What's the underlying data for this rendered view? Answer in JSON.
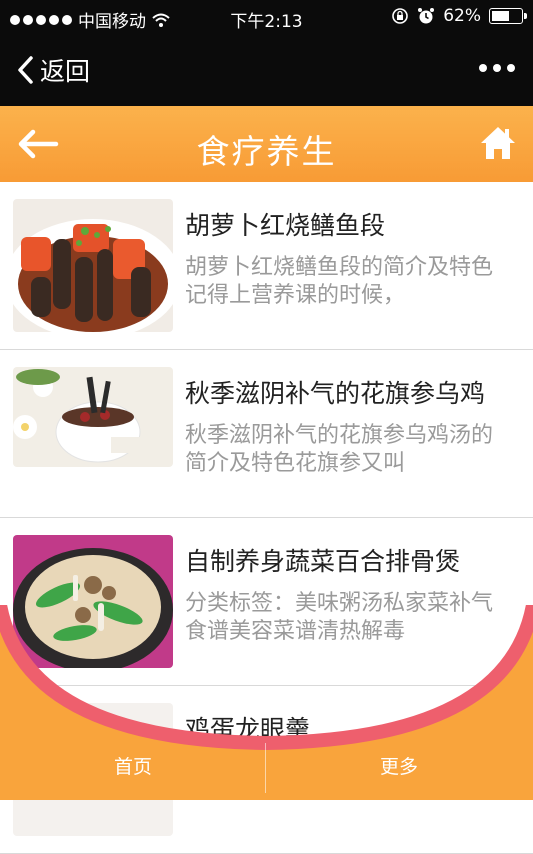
{
  "status_bar": {
    "carrier": "中国移动",
    "time": "下午2:13",
    "battery_percent": "62%",
    "battery_level": 0.62,
    "signal_icon": "signal-icon",
    "wifi_icon": "wifi-icon"
  },
  "nav": {
    "back_label": "返回",
    "more_icon": "more-icon"
  },
  "header": {
    "title": "食疗养生",
    "back_icon": "back-arrow-icon",
    "home_icon": "home-icon"
  },
  "articles": [
    {
      "title": "胡萝卜红烧鳝鱼段",
      "desc": "胡萝卜红烧鳝鱼段的简介及特色记得上营养课的时候，"
    },
    {
      "title": "秋季滋阴补气的花旗参乌鸡",
      "desc": "秋季滋阴补气的花旗参乌鸡汤的简介及特色花旗参又叫"
    },
    {
      "title": "自制养身蔬菜百合排骨煲",
      "desc": "分类标签：美味粥汤私家菜补气食谱美容菜谱清热解毒"
    },
    {
      "title": "鸡蛋龙眼羹",
      "desc": ""
    }
  ],
  "footer": {
    "home_label": "首页",
    "more_label": "更多"
  },
  "colors": {
    "header_orange": "#f89b35",
    "footer_orange": "#f9a43c",
    "wave_pink": "#ee5f6d"
  }
}
